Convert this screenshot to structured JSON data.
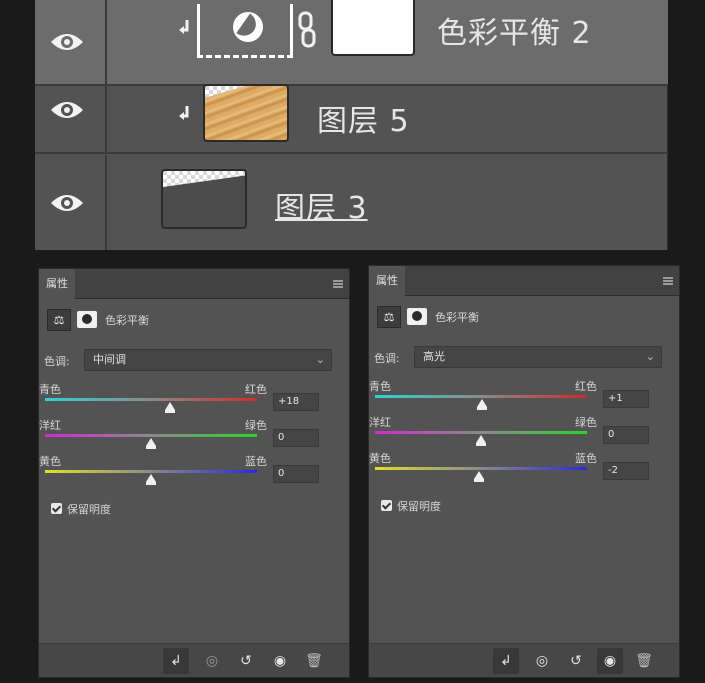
{
  "layers": [
    {
      "name": "色彩平衡 2",
      "type": "adjustment",
      "selected": true,
      "clipped": true
    },
    {
      "name": "图层 5",
      "type": "texture",
      "selected": false,
      "clipped": true
    },
    {
      "name": "图层 3",
      "type": "layer",
      "selected": false,
      "clipped": false
    }
  ],
  "panel_left": {
    "tab": "属性",
    "title": "色彩平衡",
    "tone_label": "色调:",
    "tone_value": "中间调",
    "sliders": [
      {
        "left": "青色",
        "right": "红色",
        "value": "+18",
        "position": 0.59,
        "colors": [
          "#2ad4d4",
          "#d42a2a"
        ]
      },
      {
        "left": "洋红",
        "right": "绿色",
        "value": "0",
        "position": 0.5,
        "colors": [
          "#d42ad4",
          "#2ad42a"
        ]
      },
      {
        "left": "黄色",
        "right": "蓝色",
        "value": "0",
        "position": 0.5,
        "colors": [
          "#e0e02a",
          "#2a2ae0"
        ]
      }
    ],
    "preserve_label": "保留明度",
    "preserve_checked": true
  },
  "panel_right": {
    "tab": "属性",
    "title": "色彩平衡",
    "tone_label": "色调:",
    "tone_value": "高光",
    "sliders": [
      {
        "left": "青色",
        "right": "红色",
        "value": "+1",
        "position": 0.505,
        "colors": [
          "#2ad4d4",
          "#d42a2a"
        ]
      },
      {
        "left": "洋红",
        "right": "绿色",
        "value": "0",
        "position": 0.5,
        "colors": [
          "#d42ad4",
          "#2ad42a"
        ]
      },
      {
        "left": "黄色",
        "right": "蓝色",
        "value": "-2",
        "position": 0.49,
        "colors": [
          "#e0e02a",
          "#2a2ae0"
        ]
      }
    ],
    "preserve_label": "保留明度",
    "preserve_checked": true
  },
  "footer_icons": [
    "clip-to-layer-icon",
    "view-previous-icon",
    "reset-icon",
    "visibility-icon",
    "delete-icon"
  ]
}
